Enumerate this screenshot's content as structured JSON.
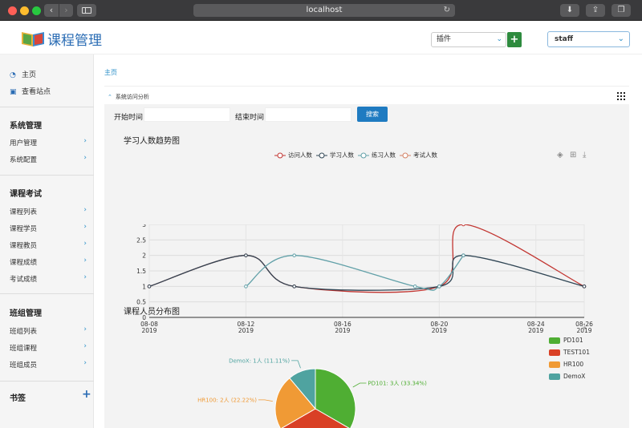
{
  "browser": {
    "url": "localhost"
  },
  "header": {
    "brand": "课程管理",
    "plugin_select": "插件",
    "user_select": "staff"
  },
  "sidebar": {
    "links": [
      {
        "label": "主页",
        "icon": "dashboard-icon"
      },
      {
        "label": "查看站点",
        "icon": "site-icon"
      }
    ],
    "groups": [
      {
        "title": "系统管理",
        "items": [
          "用户管理",
          "系统配置"
        ]
      },
      {
        "title": "课程考试",
        "items": [
          "课程列表",
          "课程学员",
          "课程教员",
          "课程成绩",
          "考试成绩"
        ]
      },
      {
        "title": "班组管理",
        "items": [
          "班组列表",
          "班组课程",
          "班组成员"
        ]
      },
      {
        "title": "书签",
        "items": []
      }
    ]
  },
  "main": {
    "breadcrumb": "主页",
    "section_title": "系统访问分析",
    "filter": {
      "start_label": "开始时间:",
      "end_label": "结束时间:",
      "search_button": "搜索"
    },
    "trend_title": "学习人数趋势图",
    "pie_title": "课程人员分布图"
  },
  "colors": {
    "accent": "#2a6cb4",
    "button": "#1f7bc1",
    "plus": "#2e8b3e"
  },
  "chart_data": [
    {
      "type": "line",
      "title": "学习人数趋势图",
      "x_ticks": [
        "08-08\n2019",
        "08-12\n2019",
        "08-16\n2019",
        "08-20\n2019",
        "08-24\n2019",
        "08-26\n2019"
      ],
      "ylim": [
        0,
        3
      ],
      "y_ticks": [
        "0",
        "0.5",
        "1",
        "1.5",
        "2",
        "2.5",
        "3"
      ],
      "grid": true,
      "legend_position": "top-center",
      "series": [
        {
          "name": "访问人数",
          "color": "#c23531",
          "points": [
            [
              "2019-08-08",
              1
            ],
            [
              "2019-08-12",
              2
            ],
            [
              "2019-08-14",
              1
            ],
            [
              "2019-08-20",
              1
            ],
            [
              "2019-08-21",
              3
            ],
            [
              "2019-08-26",
              1
            ]
          ]
        },
        {
          "name": "学习人数",
          "color": "#2f4554",
          "points": [
            [
              "2019-08-08",
              1
            ],
            [
              "2019-08-12",
              2
            ],
            [
              "2019-08-14",
              1
            ],
            [
              "2019-08-20",
              1
            ],
            [
              "2019-08-21",
              2
            ],
            [
              "2019-08-26",
              1
            ]
          ]
        },
        {
          "name": "练习人数",
          "color": "#61a0a8",
          "points": [
            [
              "2019-08-12",
              1
            ],
            [
              "2019-08-14",
              2
            ],
            [
              "2019-08-19",
              1
            ],
            [
              "2019-08-20",
              1
            ],
            [
              "2019-08-21",
              2
            ]
          ]
        },
        {
          "name": "考试人数",
          "color": "#d48265",
          "points": []
        }
      ]
    },
    {
      "type": "pie",
      "title": "课程人员分布图",
      "slices": [
        {
          "name": "PD101",
          "value": 3,
          "label": "PD101: 3人 (33.34%)",
          "color": "#4fae33"
        },
        {
          "name": "TEST101",
          "value": 3,
          "label": "",
          "color": "#d94025"
        },
        {
          "name": "HR100",
          "value": 2,
          "label": "HR100: 2人 (22.22%)",
          "color": "#f09a35"
        },
        {
          "name": "DemoX",
          "value": 1,
          "label": "DemoX: 1人 (11.11%)",
          "color": "#4fa3a0"
        }
      ],
      "legend_position": "right"
    }
  ]
}
